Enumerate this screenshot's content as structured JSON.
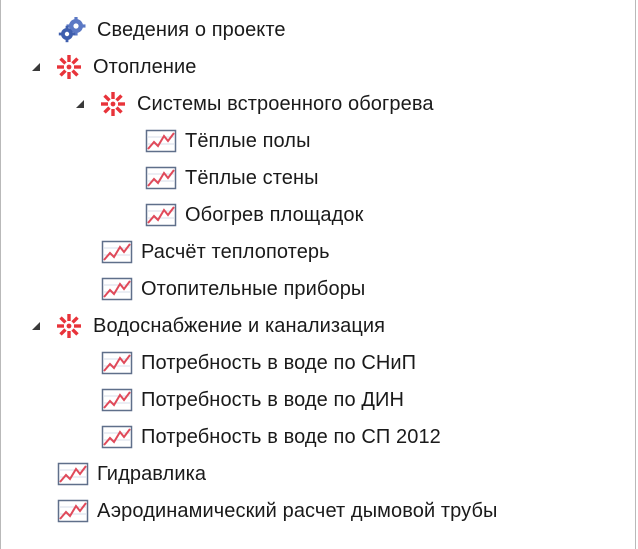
{
  "tree": {
    "items": [
      {
        "label": "Сведения о проекте",
        "icon": "gears-icon",
        "level": 0,
        "expander": "none"
      },
      {
        "label": "Отопление",
        "icon": "red-gear-icon",
        "level": 0,
        "expander": "expanded"
      },
      {
        "label": "Системы встроенного обогрева",
        "icon": "red-gear-icon",
        "level": 1,
        "expander": "expanded"
      },
      {
        "label": "Тёплые полы",
        "icon": "chart-icon",
        "level": 2,
        "expander": "none"
      },
      {
        "label": "Тёплые стены",
        "icon": "chart-icon",
        "level": 2,
        "expander": "none"
      },
      {
        "label": "Обогрев площадок",
        "icon": "chart-icon",
        "level": 2,
        "expander": "none"
      },
      {
        "label": "Расчёт теплопотерь",
        "icon": "chart-icon",
        "level": 1,
        "expander": "none"
      },
      {
        "label": "Отопительные приборы",
        "icon": "chart-icon",
        "level": 1,
        "expander": "none"
      },
      {
        "label": "Водоснабжение и канализация",
        "icon": "red-gear-icon",
        "level": 0,
        "expander": "expanded"
      },
      {
        "label": "Потребность в воде по СНиП",
        "icon": "chart-icon",
        "level": 1,
        "expander": "none"
      },
      {
        "label": "Потребность в воде по ДИН",
        "icon": "chart-icon",
        "level": 1,
        "expander": "none"
      },
      {
        "label": "Потребность в воде по СП 2012",
        "icon": "chart-icon",
        "level": 1,
        "expander": "none"
      },
      {
        "label": "Гидравлика",
        "icon": "chart-icon",
        "level": 0,
        "expander": "none"
      },
      {
        "label": "Аэродинамический расчет дымовой трубы",
        "icon": "chart-icon",
        "level": 0,
        "expander": "none"
      }
    ]
  },
  "colors": {
    "text": "#1a1a1a",
    "gear_red": "#e8333a",
    "gear_blue": "#3f5fae",
    "chart_line": "#e04a5a",
    "chart_frame": "#5f6f8a",
    "expander": "#3a3a3a"
  }
}
